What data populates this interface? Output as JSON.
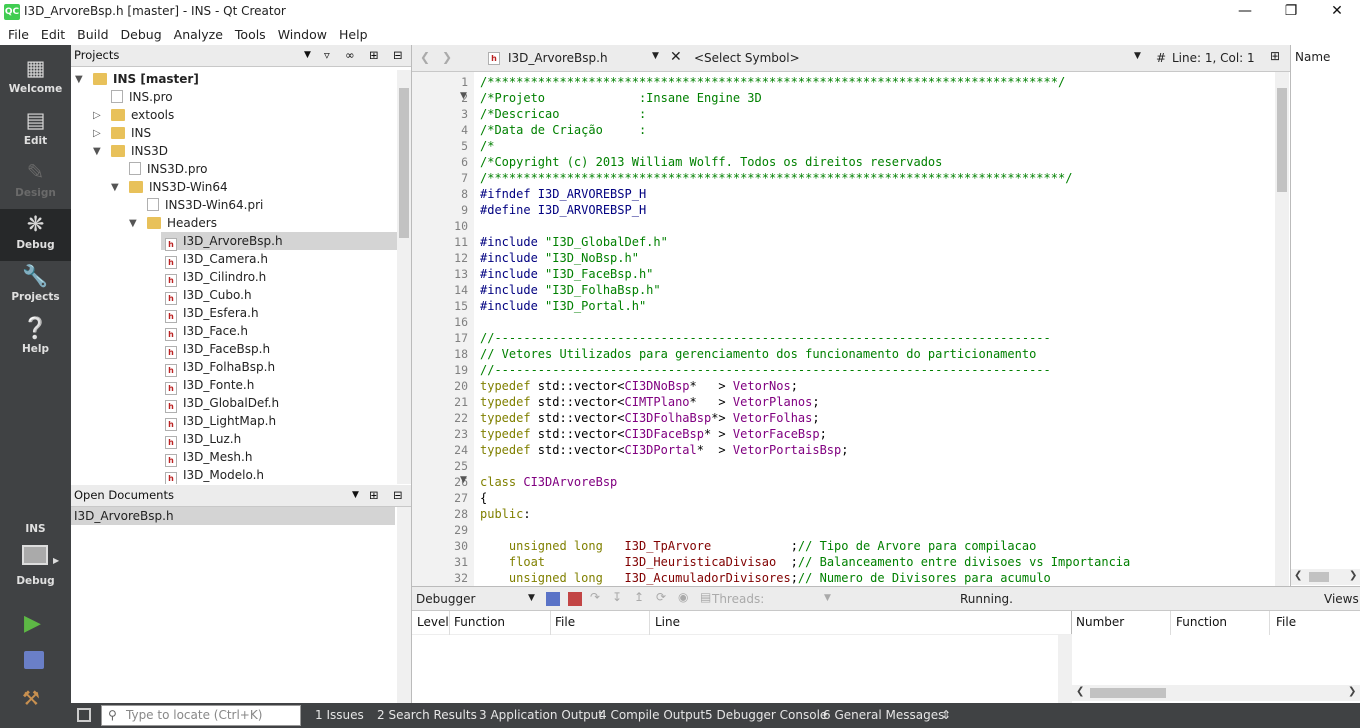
{
  "window": {
    "title": "I3D_ArvoreBsp.h [master] - INS - Qt Creator",
    "app_icon": "QC"
  },
  "menu": [
    "File",
    "Edit",
    "Build",
    "Debug",
    "Analyze",
    "Tools",
    "Window",
    "Help"
  ],
  "modes": [
    {
      "label": "Welcome",
      "icon": "grid-icon"
    },
    {
      "label": "Edit",
      "icon": "document-icon"
    },
    {
      "label": "Design",
      "icon": "pencil-icon"
    },
    {
      "label": "Debug",
      "icon": "bug-icon"
    },
    {
      "label": "Projects",
      "icon": "wrench-icon"
    },
    {
      "label": "Help",
      "icon": "question-icon"
    }
  ],
  "kit": {
    "project": "INS",
    "config": "Debug"
  },
  "projects_pane": {
    "title": "Projects",
    "tree": [
      {
        "label": "INS [master]",
        "bold": true
      },
      {
        "label": "INS.pro"
      },
      {
        "label": "extools"
      },
      {
        "label": "INS"
      },
      {
        "label": "INS3D"
      },
      {
        "label": "INS3D.pro"
      },
      {
        "label": "INS3D-Win64"
      },
      {
        "label": "INS3D-Win64.pri"
      },
      {
        "label": "Headers"
      },
      {
        "label": "I3D_ArvoreBsp.h"
      },
      {
        "label": "I3D_Camera.h"
      },
      {
        "label": "I3D_Cilindro.h"
      },
      {
        "label": "I3D_Cubo.h"
      },
      {
        "label": "I3D_Esfera.h"
      },
      {
        "label": "I3D_Face.h"
      },
      {
        "label": "I3D_FaceBsp.h"
      },
      {
        "label": "I3D_FolhaBsp.h"
      },
      {
        "label": "I3D_Fonte.h"
      },
      {
        "label": "I3D_GlobalDef.h"
      },
      {
        "label": "I3D_LightMap.h"
      },
      {
        "label": "I3D_Luz.h"
      },
      {
        "label": "I3D_Mesh.h"
      },
      {
        "label": "I3D_Modelo.h"
      }
    ]
  },
  "open_documents": {
    "title": "Open Documents",
    "items": [
      "I3D_ArvoreBsp.h"
    ]
  },
  "editor": {
    "filename": "I3D_ArvoreBsp.h",
    "symbol": "<Select Symbol>",
    "hash": "#",
    "position": "Line: 1, Col: 1",
    "lines": [
      "/*******************************************************************************/",
      "/*Projeto             :Insane Engine 3D",
      "/*Descricao           :",
      "/*Data de Criação     :",
      "/*",
      "/*Copyright (c) 2013 William Wolff. Todos os direitos reservados",
      "/********************************************************************************/",
      "#ifndef I3D_ARVOREBSP_H",
      "#define I3D_ARVOREBSP_H",
      "",
      "#include \"I3D_GlobalDef.h\"",
      "#include \"I3D_NoBsp.h\"",
      "#include \"I3D_FaceBsp.h\"",
      "#include \"I3D_FolhaBsp.h\"",
      "#include \"I3D_Portal.h\"",
      "",
      "//-----------------------------------------------------------------------------",
      "// Vetores Utilizados para gerenciamento dos funcionamento do particionamento",
      "//-----------------------------------------------------------------------------",
      "typedef std::vector<CI3DNoBsp*   > VetorNos;",
      "typedef std::vector<CIMTPlano*   > VetorPlanos;",
      "typedef std::vector<CI3DFolhaBsp*> VetorFolhas;",
      "typedef std::vector<CI3DFaceBsp* > VetorFaceBsp;",
      "typedef std::vector<CI3DPortal*  > VetorPortaisBsp;",
      "",
      "class CI3DArvoreBsp",
      "{",
      "public:",
      "",
      "    unsigned long   I3D_TpArvore           ;// Tipo de Arvore para compilacao",
      "    float           I3D_HeuristicaDivisao  ;// Balanceamento entre divisoes vs Importancia",
      "    unsigned long   I3D_AcumuladorDivisores;// Numero de Divisores para acumulo"
    ]
  },
  "right_pane": {
    "title": "Name"
  },
  "debugger": {
    "label": "Debugger",
    "threads": "Threads:",
    "status": "Running.",
    "views": "Views",
    "stack_columns": [
      "Level",
      "Function",
      "File",
      "Line"
    ],
    "break_columns": [
      "Number",
      "Function",
      "File"
    ]
  },
  "statusbar": {
    "locator_placeholder": "Type to locate (Ctrl+K)",
    "tabs": [
      "1  Issues",
      "2  Search Results",
      "3  Application Output",
      "4  Compile Output",
      "5  Debugger Console",
      "6  General Messages"
    ]
  },
  "colors": {
    "modebar": "#404244",
    "active_mode": "#262829",
    "comment": "#008000",
    "keyword": "#808000",
    "preproc": "#000080",
    "type": "#800080"
  }
}
